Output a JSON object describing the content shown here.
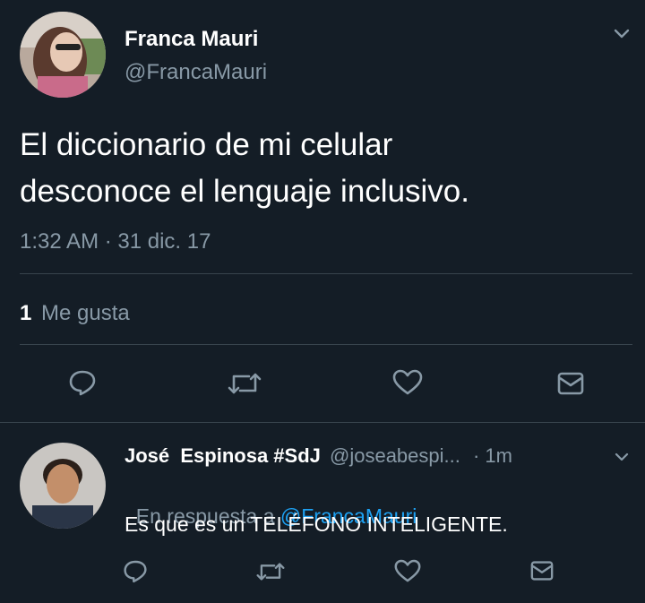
{
  "main_tweet": {
    "author_name": "Franca Mauri",
    "author_handle": "@FrancaMauri",
    "text_line1": "El diccionario de mi celular",
    "text_line2": "desconoce el lenguaje inclusivo.",
    "timestamp": "1:32 AM · 31 dic. 17",
    "likes_count": "1",
    "likes_label": "Me gusta",
    "actions": [
      "reply-icon",
      "retweet-icon",
      "like-icon",
      "dm-icon"
    ]
  },
  "reply_tweet": {
    "author_name": "José  Espinosa #SdJ",
    "author_handle": "@joseabespi...",
    "time": "· 1m",
    "reply_prefix": "En respuesta a ",
    "reply_to": "@FrancaMauri",
    "text": "Es que es un TELÉFONO INTELIGENTE.",
    "actions": [
      "reply-icon",
      "retweet-icon",
      "like-icon",
      "dm-icon"
    ]
  },
  "colors": {
    "background": "#141d26",
    "muted": "#8899a6",
    "link": "#1da1f2",
    "divider": "#38444d"
  }
}
